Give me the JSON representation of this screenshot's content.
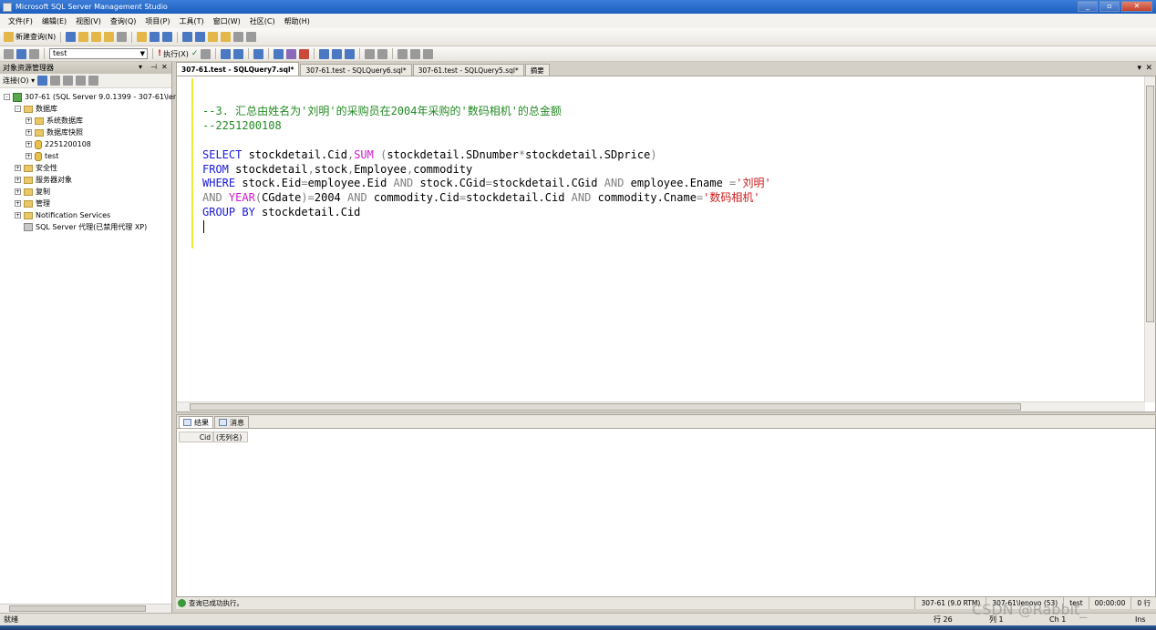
{
  "window": {
    "title": "Microsoft SQL Server Management Studio"
  },
  "menu": [
    "文件(F)",
    "编辑(E)",
    "视图(V)",
    "查询(Q)",
    "项目(P)",
    "工具(T)",
    "窗口(W)",
    "社区(C)",
    "帮助(H)"
  ],
  "toolbar": {
    "new_query_label": "新建查询(N)",
    "database_selector_value": "test",
    "execute_label": "执行(X)"
  },
  "object_explorer": {
    "title": "对象资源管理器",
    "connect_label": "连接(O)",
    "tree": [
      {
        "label": "307-61 (SQL Server 9.0.1399 - 307-61\\len",
        "indent": 0,
        "icon": "server-icon",
        "expander": "-"
      },
      {
        "label": "数据库",
        "indent": 1,
        "icon": "folder-icon",
        "expander": "-"
      },
      {
        "label": "系统数据库",
        "indent": 2,
        "icon": "folder-icon",
        "expander": "+"
      },
      {
        "label": "数据库快照",
        "indent": 2,
        "icon": "folder-icon",
        "expander": "+"
      },
      {
        "label": "2251200108",
        "indent": 2,
        "icon": "database-icon",
        "expander": "+"
      },
      {
        "label": "test",
        "indent": 2,
        "icon": "database-icon",
        "expander": "+"
      },
      {
        "label": "安全性",
        "indent": 1,
        "icon": "folder-icon",
        "expander": "+"
      },
      {
        "label": "服务器对象",
        "indent": 1,
        "icon": "folder-icon",
        "expander": "+"
      },
      {
        "label": "复制",
        "indent": 1,
        "icon": "folder-icon",
        "expander": "+"
      },
      {
        "label": "管理",
        "indent": 1,
        "icon": "folder-icon",
        "expander": "+"
      },
      {
        "label": "Notification Services",
        "indent": 1,
        "icon": "folder-icon",
        "expander": "+"
      },
      {
        "label": "SQL Server 代理(已禁用代理 XP)",
        "indent": 1,
        "icon": "agent-icon",
        "expander": ""
      }
    ]
  },
  "tabs": [
    {
      "label": "307-61.test - SQLQuery7.sql*",
      "active": true
    },
    {
      "label": "307-61.test - SQLQuery6.sql*",
      "active": false
    },
    {
      "label": "307-61.test - SQLQuery5.sql*",
      "active": false
    },
    {
      "label": "摘要",
      "active": false
    }
  ],
  "editor": {
    "lines": [
      [
        {
          "t": "--3. 汇总由姓名为'刘明'的采购员在2004年采购的'数码相机'的总金额",
          "c": "cm"
        }
      ],
      [
        {
          "t": "--2251200108",
          "c": "cm"
        }
      ],
      [],
      [
        {
          "t": "SELECT",
          "c": "kw"
        },
        {
          "t": " stockdetail.Cid",
          "c": ""
        },
        {
          "t": ",",
          "c": "op"
        },
        {
          "t": "SUM",
          "c": "fn"
        },
        {
          "t": " (",
          "c": "op"
        },
        {
          "t": "stockdetail.SDnumber",
          "c": ""
        },
        {
          "t": "*",
          "c": "op"
        },
        {
          "t": "stockdetail.SDprice",
          "c": ""
        },
        {
          "t": ")",
          "c": "op"
        }
      ],
      [
        {
          "t": "FROM",
          "c": "kw"
        },
        {
          "t": " stockdetail",
          "c": ""
        },
        {
          "t": ",",
          "c": "op"
        },
        {
          "t": "stock",
          "c": ""
        },
        {
          "t": ",",
          "c": "op"
        },
        {
          "t": "Employee",
          "c": ""
        },
        {
          "t": ",",
          "c": "op"
        },
        {
          "t": "commodity",
          "c": ""
        }
      ],
      [
        {
          "t": "WHERE",
          "c": "kw"
        },
        {
          "t": " stock.Eid",
          "c": ""
        },
        {
          "t": "=",
          "c": "op"
        },
        {
          "t": "employee.Eid ",
          "c": ""
        },
        {
          "t": "AND",
          "c": "op"
        },
        {
          "t": " stock.CGid",
          "c": ""
        },
        {
          "t": "=",
          "c": "op"
        },
        {
          "t": "stockdetail.CGid ",
          "c": ""
        },
        {
          "t": "AND",
          "c": "op"
        },
        {
          "t": " employee.Ename ",
          "c": ""
        },
        {
          "t": "=",
          "c": "op"
        },
        {
          "t": "'刘明'",
          "c": "str"
        }
      ],
      [
        {
          "t": "AND",
          "c": "op"
        },
        {
          "t": " ",
          "c": ""
        },
        {
          "t": "YEAR",
          "c": "fn"
        },
        {
          "t": "(",
          "c": "op"
        },
        {
          "t": "CGdate",
          "c": ""
        },
        {
          "t": ")=",
          "c": "op"
        },
        {
          "t": "2004 ",
          "c": ""
        },
        {
          "t": "AND",
          "c": "op"
        },
        {
          "t": " commodity.Cid",
          "c": ""
        },
        {
          "t": "=",
          "c": "op"
        },
        {
          "t": "stockdetail.Cid ",
          "c": ""
        },
        {
          "t": "AND",
          "c": "op"
        },
        {
          "t": " commodity.Cname",
          "c": ""
        },
        {
          "t": "=",
          "c": "op"
        },
        {
          "t": "'数码相机'",
          "c": "str"
        }
      ],
      [
        {
          "t": "GROUP BY",
          "c": "kw"
        },
        {
          "t": " stockdetail.Cid",
          "c": ""
        }
      ]
    ]
  },
  "results": {
    "tab_results": "结果",
    "tab_messages": "消息",
    "columns": [
      "Cid",
      "(无列名)"
    ]
  },
  "exec_status": {
    "message": "查询已成功执行。",
    "server": "307-61 (9.0 RTM)",
    "user": "307-61\\lenovo (53)",
    "database": "test",
    "elapsed": "00:00:00",
    "rows": "0 行"
  },
  "statusbar": {
    "ready": "就绪",
    "line": "行 26",
    "col": "列 1",
    "ch": "Ch 1",
    "mode": "Ins"
  },
  "watermark": "CSDN @Rabbit_"
}
